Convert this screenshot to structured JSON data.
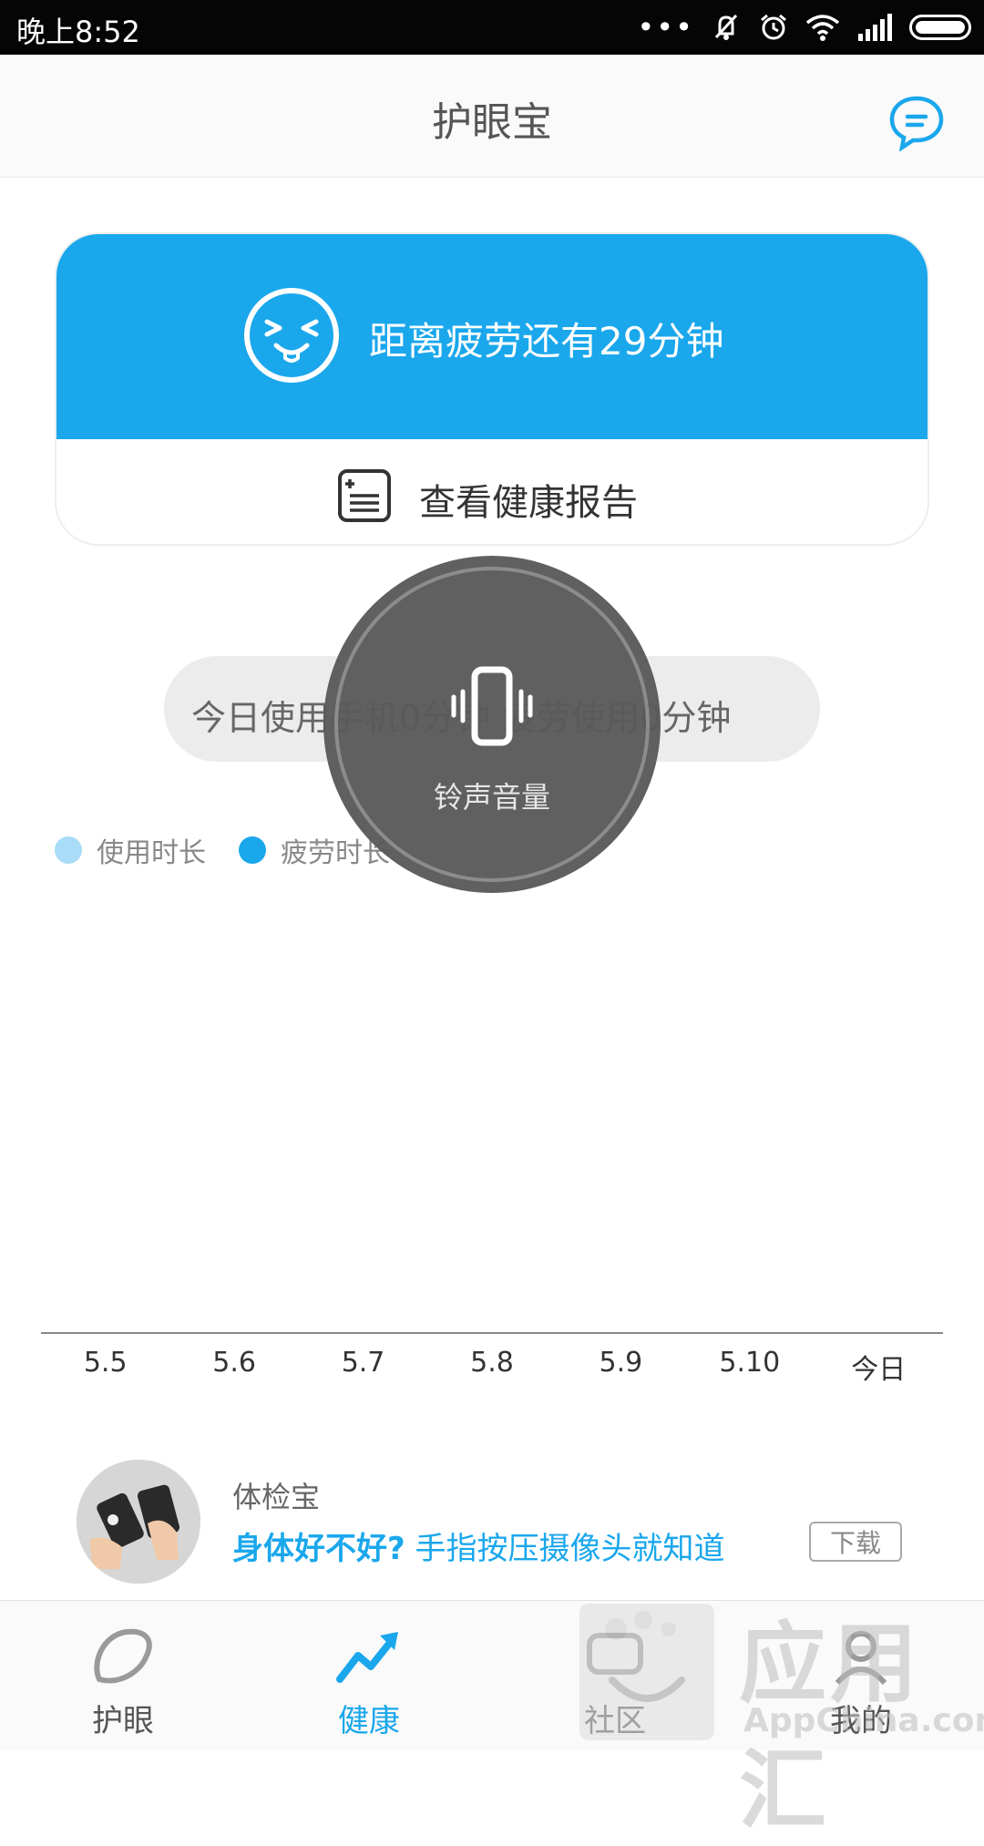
{
  "status_bar": {
    "time": "晚上8:52",
    "dots": "•••"
  },
  "header": {
    "title": "护眼宝"
  },
  "card": {
    "fatigue_text": "距离疲劳还有29分钟",
    "report_label": "查看健康报告"
  },
  "usage": {
    "text": "今日使用手机0分钟    疲劳使用0分钟"
  },
  "legend": [
    {
      "label": "使用时长",
      "color": "#a8dcf7"
    },
    {
      "label": "疲劳时长",
      "color": "#1aa7ec"
    }
  ],
  "volume_overlay": {
    "label": "铃声音量"
  },
  "chart_axis": {
    "labels": [
      "5.5",
      "5.6",
      "5.7",
      "5.8",
      "5.9",
      "5.10",
      "今日"
    ]
  },
  "ad": {
    "name": "体检宝",
    "slogan_question": "身体好不好?",
    "slogan_rest": "手指按压摄像头就知道",
    "download": "下载"
  },
  "nav": {
    "items": [
      {
        "label": "护眼",
        "icon": "eye-icon",
        "color": "#555555"
      },
      {
        "label": "健康",
        "icon": "trend-icon",
        "color": "#1aa7ec"
      },
      {
        "label": "社区",
        "icon": "community-icon",
        "color": "#555555"
      },
      {
        "label": "我的",
        "icon": "user-icon",
        "color": "#555555"
      }
    ]
  },
  "watermark": {
    "big": "应用汇",
    "small": "AppChina.com"
  },
  "colors": {
    "accent": "#1aa7ec",
    "light_accent": "#a8dcf7"
  }
}
